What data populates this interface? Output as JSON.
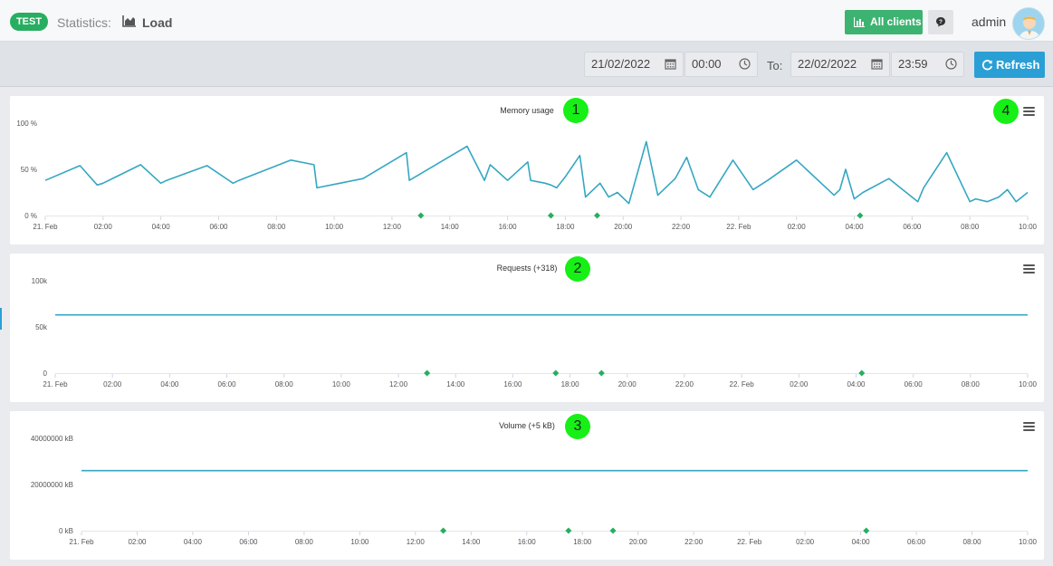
{
  "header": {
    "badge": "TEST",
    "breadcrumb_label": "Statistics:",
    "page_title": "Load",
    "clients_button": "All clients",
    "username": "admin"
  },
  "filters": {
    "from_date": "21/02/2022",
    "from_time": "00:00",
    "to_label": "To:",
    "to_date": "22/02/2022",
    "to_time": "23:59",
    "refresh_label": "Refresh"
  },
  "colors": {
    "accent": "#2a9fd6",
    "line": "#35a7c2",
    "event_marker": "#27ae60",
    "badge": "#27ae60"
  },
  "annotations": [
    "1",
    "2",
    "3",
    "4"
  ],
  "chart_data": [
    {
      "type": "line",
      "title": "Memory usage",
      "x_ticks": [
        "21. Feb",
        "02:00",
        "04:00",
        "06:00",
        "08:00",
        "10:00",
        "12:00",
        "14:00",
        "16:00",
        "18:00",
        "20:00",
        "22:00",
        "22. Feb",
        "02:00",
        "04:00",
        "06:00",
        "08:00",
        "10:00"
      ],
      "y_ticks": [
        "0 %",
        "50 %",
        "100 %"
      ],
      "ylim": [
        0,
        100
      ],
      "xlim": [
        0,
        34
      ],
      "series": [
        {
          "x": [
            0,
            1.2,
            1.8,
            2.0,
            3.3,
            4.0,
            4.2,
            5.6,
            6.5,
            6.7,
            8.5,
            9.3,
            9.4,
            11,
            12.5,
            12.6,
            14.6,
            15.2,
            15.4,
            16,
            16.7,
            16.8,
            17.3,
            17.5,
            17.7,
            18,
            18.5,
            18.7,
            19.2,
            19.5,
            19.8,
            20.2,
            20.8,
            21.2,
            21.8,
            22.2,
            22.6,
            23.0,
            23.8,
            24.5,
            25,
            26,
            27.3,
            27.5,
            27.7,
            28,
            28.3,
            29.2,
            30.2,
            30.4,
            31.2,
            32,
            32.2,
            32.6,
            33.0,
            33.3,
            33.6,
            34
          ],
          "y": [
            38,
            54,
            33,
            35,
            55,
            35,
            38,
            54,
            35,
            38,
            60,
            55,
            30,
            40,
            68,
            38,
            75,
            38,
            55,
            38,
            58,
            38,
            35,
            33,
            30,
            42,
            65,
            20,
            35,
            20,
            25,
            13,
            80,
            22,
            40,
            63,
            28,
            20,
            60,
            28,
            38,
            60,
            22,
            28,
            50,
            18,
            25,
            40,
            15,
            30,
            68,
            15,
            18,
            15,
            20,
            28,
            15,
            25
          ]
        }
      ],
      "events_x": [
        13.0,
        17.5,
        19.1,
        28.2
      ]
    },
    {
      "type": "line",
      "title": "Requests (+318)",
      "x_ticks": [
        "21. Feb",
        "02:00",
        "04:00",
        "06:00",
        "08:00",
        "10:00",
        "12:00",
        "14:00",
        "16:00",
        "18:00",
        "20:00",
        "22:00",
        "22. Feb",
        "02:00",
        "04:00",
        "06:00",
        "08:00",
        "10:00"
      ],
      "y_ticks": [
        "0",
        "50k",
        "100k"
      ],
      "ylim": [
        0,
        100000
      ],
      "xlim": [
        0,
        34
      ],
      "series": [
        {
          "x": [
            0,
            34
          ],
          "y": [
            63000,
            63000
          ]
        }
      ],
      "events_x": [
        13.0,
        17.5,
        19.1,
        28.2
      ]
    },
    {
      "type": "line",
      "title": "Volume (+5 kB)",
      "x_ticks": [
        "21. Feb",
        "02:00",
        "04:00",
        "06:00",
        "08:00",
        "10:00",
        "12:00",
        "14:00",
        "16:00",
        "18:00",
        "20:00",
        "22:00",
        "22. Feb",
        "02:00",
        "04:00",
        "06:00",
        "08:00",
        "10:00"
      ],
      "y_ticks": [
        "0 kB",
        "20000000 kB",
        "40000000 kB"
      ],
      "ylim": [
        0,
        40000000
      ],
      "xlim": [
        0,
        34
      ],
      "series": [
        {
          "x": [
            0,
            34
          ],
          "y": [
            26000000,
            26000000
          ]
        }
      ],
      "events_x": [
        13.0,
        17.5,
        19.1,
        28.2
      ]
    }
  ]
}
